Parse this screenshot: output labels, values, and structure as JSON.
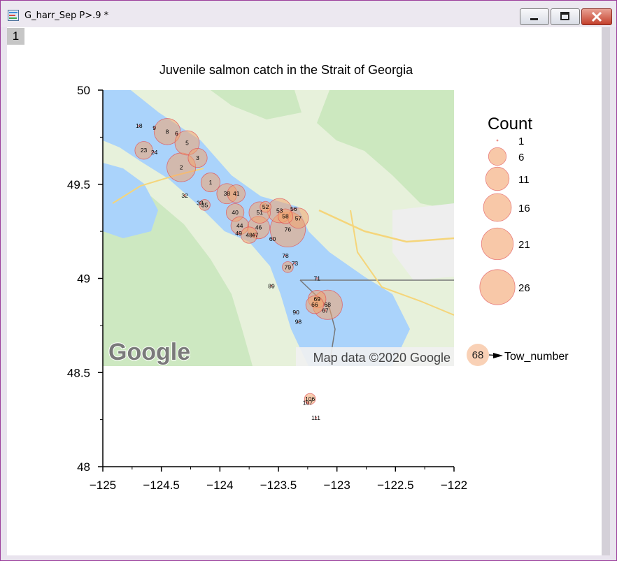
{
  "window": {
    "title": "G_harr_Sep P>.9 *",
    "layer_tab": "1"
  },
  "chart_data": {
    "type": "scatter",
    "title": "Juvenile salmon catch in the Strait of Georgia",
    "xlabel": "",
    "ylabel": "",
    "xlim": [
      -125,
      -122
    ],
    "ylim": [
      48,
      50
    ],
    "xticks": [
      -125,
      -124.5,
      -124,
      -123.5,
      -123,
      -122.5,
      -122
    ],
    "xtick_labels": [
      "−125",
      "−124.5",
      "−124",
      "−123.5",
      "−123",
      "−122.5",
      "−122"
    ],
    "yticks": [
      48,
      48.5,
      49,
      49.5,
      50
    ],
    "ytick_labels": [
      "48",
      "48.5",
      "49",
      "49.5",
      "50"
    ],
    "grid": false,
    "basemap": {
      "extent_lon": [
        -125,
        -122
      ],
      "extent_lat": [
        48.53,
        50
      ],
      "logo_text": "Google",
      "attribution": "Map data ©2020 Google"
    },
    "size_legend": {
      "title": "Count",
      "sizes": [
        1,
        6,
        11,
        16,
        21,
        26
      ],
      "labels": [
        "1",
        "6",
        "11",
        "16",
        "21",
        "26"
      ]
    },
    "label_legend": {
      "sample": "68",
      "label": "Tow_number"
    },
    "colors": {
      "bubble_fill": "#f3a46e",
      "bubble_edge": "#e0525a",
      "water": "#aad3fb",
      "land": "#e7f1db",
      "park": "#c7e6ba"
    },
    "points": [
      {
        "tow": "18",
        "lon": -124.69,
        "lat": 49.81,
        "count": 1
      },
      {
        "tow": "9",
        "lon": -124.56,
        "lat": 49.8,
        "count": 1
      },
      {
        "tow": "8",
        "lon": -124.45,
        "lat": 49.78,
        "count": 14
      },
      {
        "tow": "6",
        "lon": -124.37,
        "lat": 49.77,
        "count": 1
      },
      {
        "tow": "5",
        "lon": -124.28,
        "lat": 49.72,
        "count": 12
      },
      {
        "tow": "3",
        "lon": -124.19,
        "lat": 49.64,
        "count": 7
      },
      {
        "tow": "23",
        "lon": -124.65,
        "lat": 49.68,
        "count": 6
      },
      {
        "tow": "24",
        "lon": -124.56,
        "lat": 49.67,
        "count": 1
      },
      {
        "tow": "2",
        "lon": -124.33,
        "lat": 49.59,
        "count": 17
      },
      {
        "tow": "1",
        "lon": -124.08,
        "lat": 49.51,
        "count": 7
      },
      {
        "tow": "32",
        "lon": -124.3,
        "lat": 49.44,
        "count": 1
      },
      {
        "tow": "33",
        "lon": -124.17,
        "lat": 49.4,
        "count": 1
      },
      {
        "tow": "35",
        "lon": -124.13,
        "lat": 49.39,
        "count": 2
      },
      {
        "tow": "38",
        "lon": -123.94,
        "lat": 49.45,
        "count": 8
      },
      {
        "tow": "41",
        "lon": -123.86,
        "lat": 49.45,
        "count": 6
      },
      {
        "tow": "40",
        "lon": -123.87,
        "lat": 49.35,
        "count": 6
      },
      {
        "tow": "52",
        "lon": -123.61,
        "lat": 49.38,
        "count": 2
      },
      {
        "tow": "51",
        "lon": -123.66,
        "lat": 49.35,
        "count": 9
      },
      {
        "tow": "53",
        "lon": -123.49,
        "lat": 49.36,
        "count": 12
      },
      {
        "tow": "56",
        "lon": -123.37,
        "lat": 49.37,
        "count": 1
      },
      {
        "tow": "58",
        "lon": -123.44,
        "lat": 49.33,
        "count": 4
      },
      {
        "tow": "57",
        "lon": -123.33,
        "lat": 49.32,
        "count": 8
      },
      {
        "tow": "44",
        "lon": -123.83,
        "lat": 49.28,
        "count": 6
      },
      {
        "tow": "46",
        "lon": -123.67,
        "lat": 49.27,
        "count": 10
      },
      {
        "tow": "76",
        "lon": -123.42,
        "lat": 49.26,
        "count": 26
      },
      {
        "tow": "49",
        "lon": -123.84,
        "lat": 49.24,
        "count": 1
      },
      {
        "tow": "48",
        "lon": -123.75,
        "lat": 49.23,
        "count": 5
      },
      {
        "tow": "47",
        "lon": -123.7,
        "lat": 49.23,
        "count": 1
      },
      {
        "tow": "60",
        "lon": -123.55,
        "lat": 49.21,
        "count": 1
      },
      {
        "tow": "78",
        "lon": -123.44,
        "lat": 49.12,
        "count": 1
      },
      {
        "tow": "73",
        "lon": -123.36,
        "lat": 49.08,
        "count": 1
      },
      {
        "tow": "79",
        "lon": -123.42,
        "lat": 49.06,
        "count": 2
      },
      {
        "tow": "71",
        "lon": -123.17,
        "lat": 49.0,
        "count": 1
      },
      {
        "tow": "89",
        "lon": -123.56,
        "lat": 48.96,
        "count": 1
      },
      {
        "tow": "69",
        "lon": -123.17,
        "lat": 48.89,
        "count": 6
      },
      {
        "tow": "66",
        "lon": -123.19,
        "lat": 48.86,
        "count": 6
      },
      {
        "tow": "68",
        "lon": -123.08,
        "lat": 48.86,
        "count": 18
      },
      {
        "tow": "67",
        "lon": -123.1,
        "lat": 48.83,
        "count": 1
      },
      {
        "tow": "90",
        "lon": -123.35,
        "lat": 48.82,
        "count": 1
      },
      {
        "tow": "98",
        "lon": -123.33,
        "lat": 48.77,
        "count": 1
      },
      {
        "tow": "106",
        "lon": -123.23,
        "lat": 48.36,
        "count": 2
      },
      {
        "tow": "107",
        "lon": -123.25,
        "lat": 48.34,
        "count": 1
      },
      {
        "tow": "111",
        "lon": -123.18,
        "lat": 48.26,
        "count": 1
      }
    ]
  }
}
